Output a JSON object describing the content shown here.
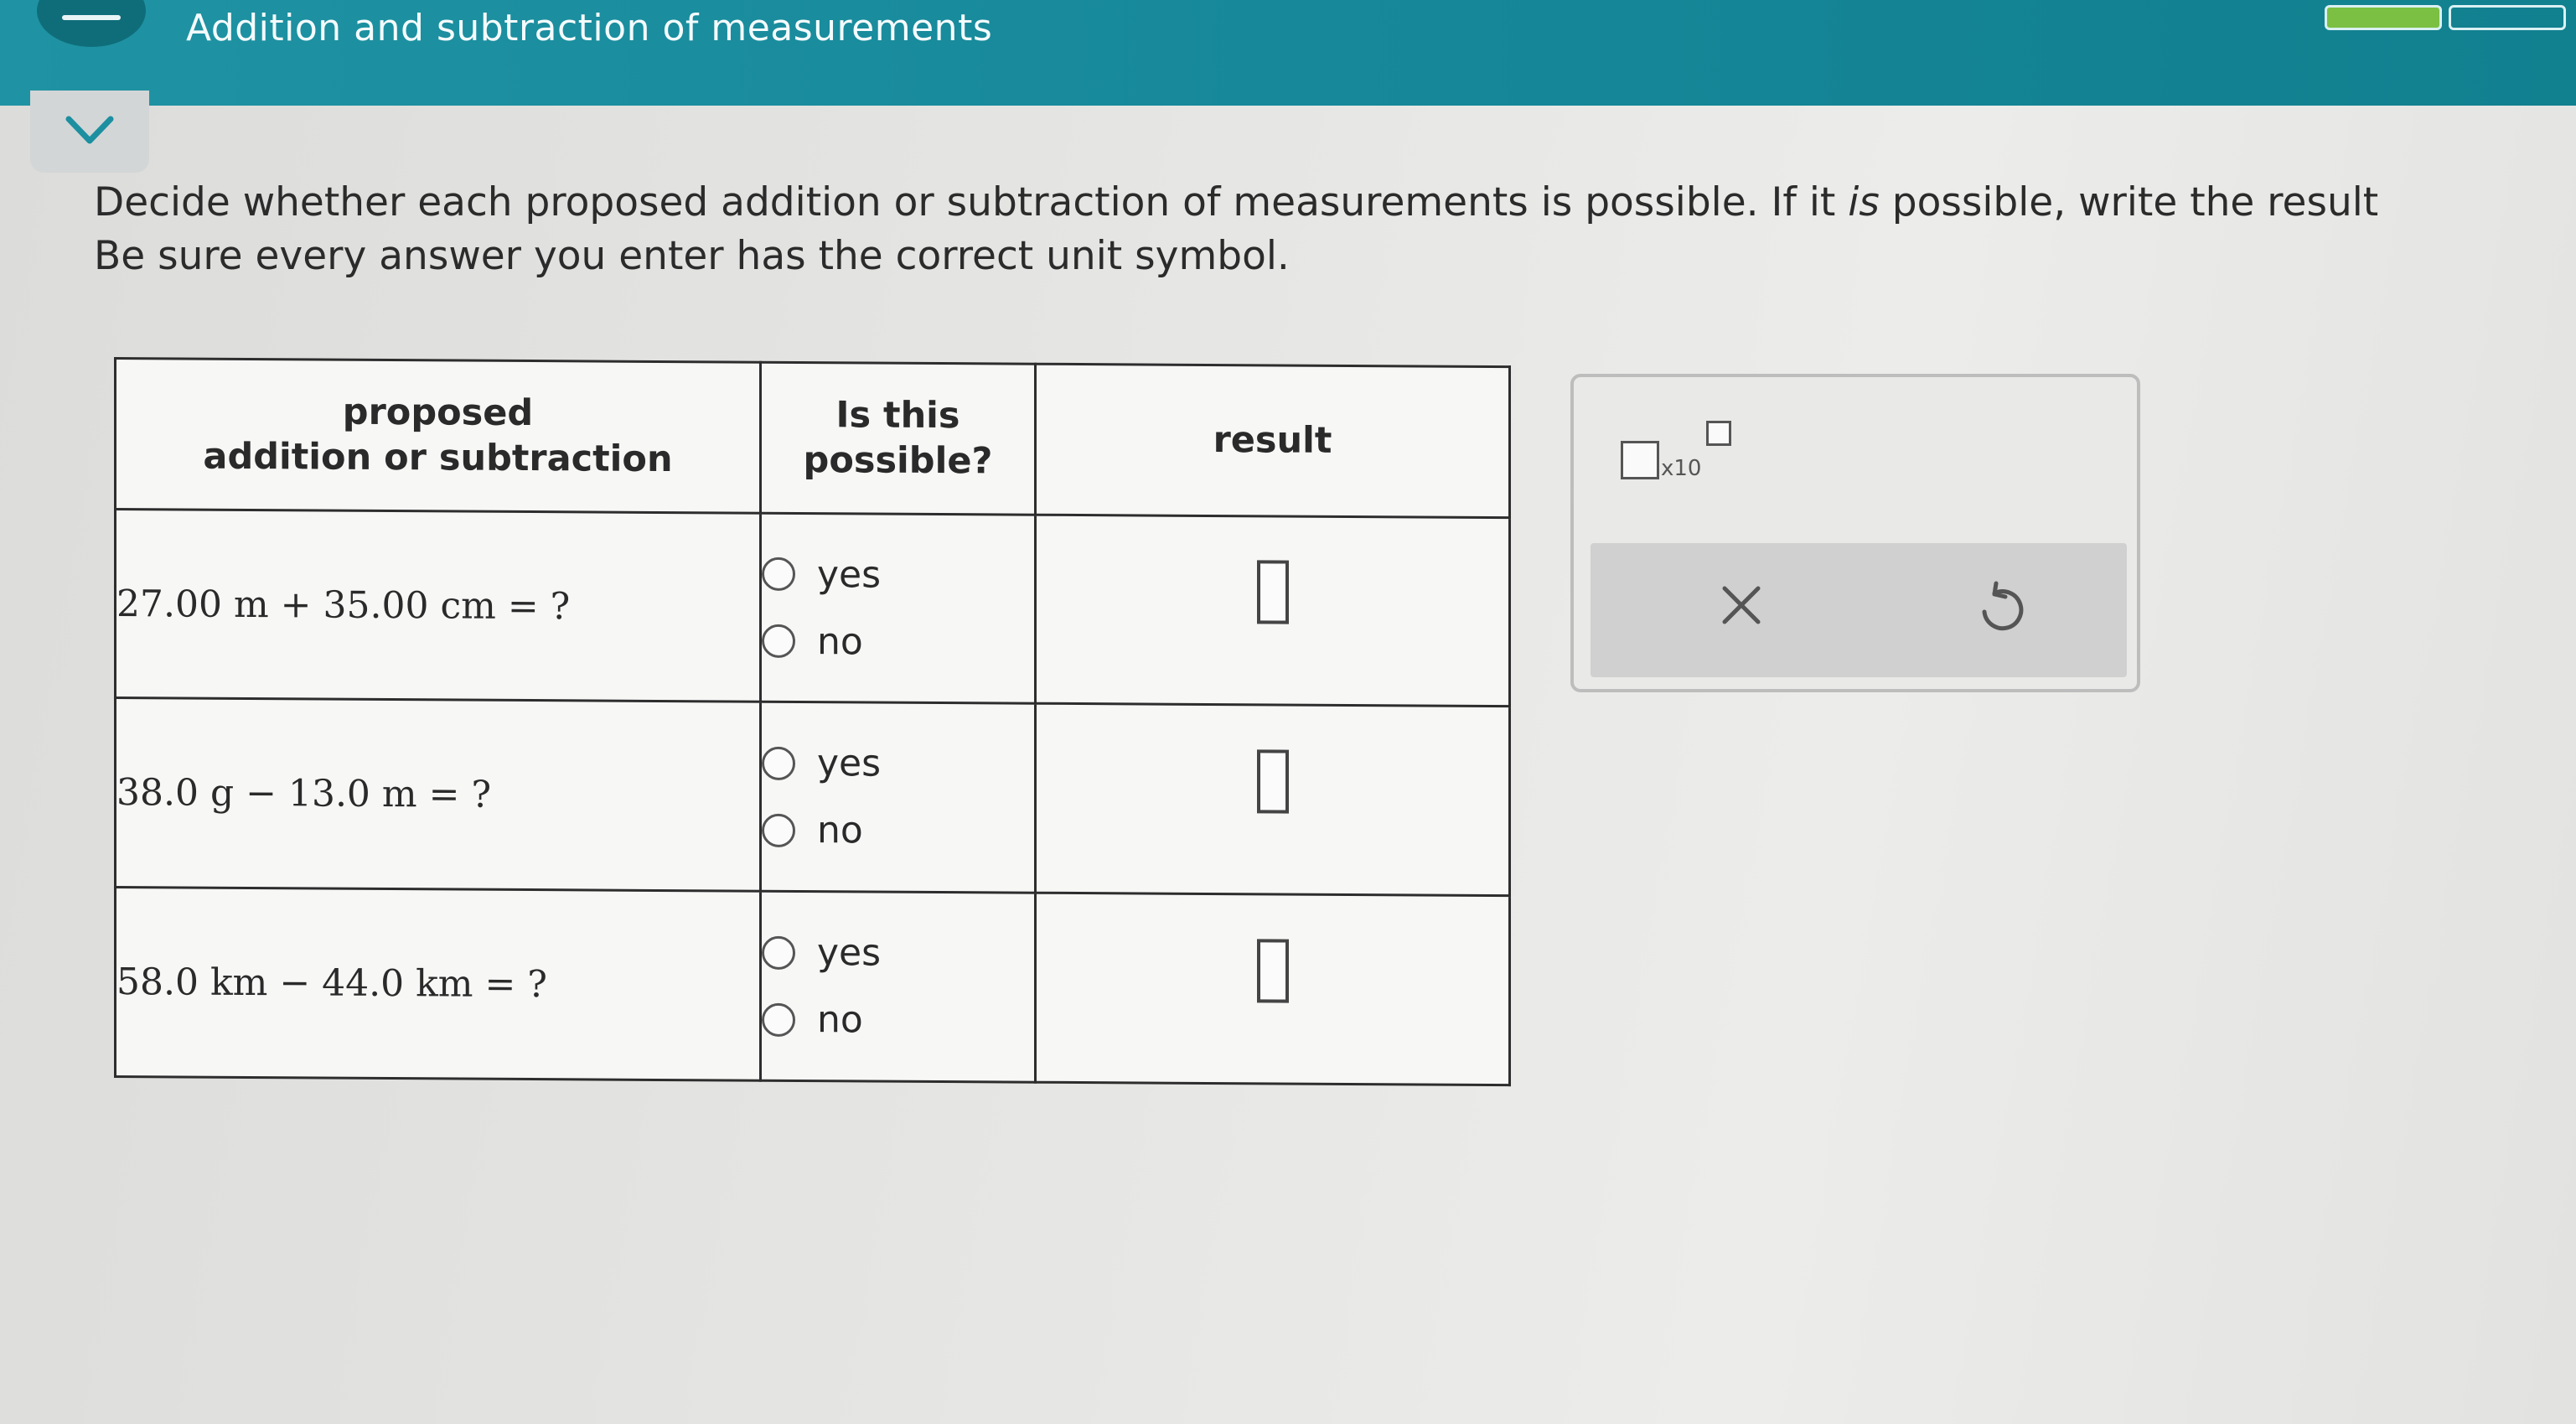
{
  "header": {
    "topic_title": "Addition and subtraction of measurements",
    "progress_segments": [
      {
        "state": "complete",
        "color": "#7bc043"
      },
      {
        "state": "incomplete",
        "color": "#11808f"
      }
    ]
  },
  "instructions": {
    "line1_part1": "Decide whether each proposed addition or subtraction of measurements is possible. If it ",
    "line1_emphasis": "is",
    "line1_part2": " possible, write the result",
    "line2": "Be sure every answer you enter has the correct unit symbol."
  },
  "table": {
    "headers": {
      "col1_line1": "proposed",
      "col1_line2": "addition or subtraction",
      "col2_line1": "Is this",
      "col2_line2": "possible?",
      "col3": "result"
    },
    "rows": [
      {
        "expression": "27.00 m + 35.00 cm = ?",
        "yes_label": "yes",
        "no_label": "no",
        "selected": null,
        "result": ""
      },
      {
        "expression": "38.0 g − 13.0 m = ?",
        "yes_label": "yes",
        "no_label": "no",
        "selected": null,
        "result": ""
      },
      {
        "expression": "58.0 km − 44.0 km = ?",
        "yes_label": "yes",
        "no_label": "no",
        "selected": null,
        "result": ""
      }
    ]
  },
  "tool_panel": {
    "scientific_notation_label": "x10",
    "clear_icon": "x-icon",
    "undo_icon": "undo-icon"
  },
  "colors": {
    "header_bg": "#1a8c9c",
    "progress_complete": "#7bc043"
  }
}
